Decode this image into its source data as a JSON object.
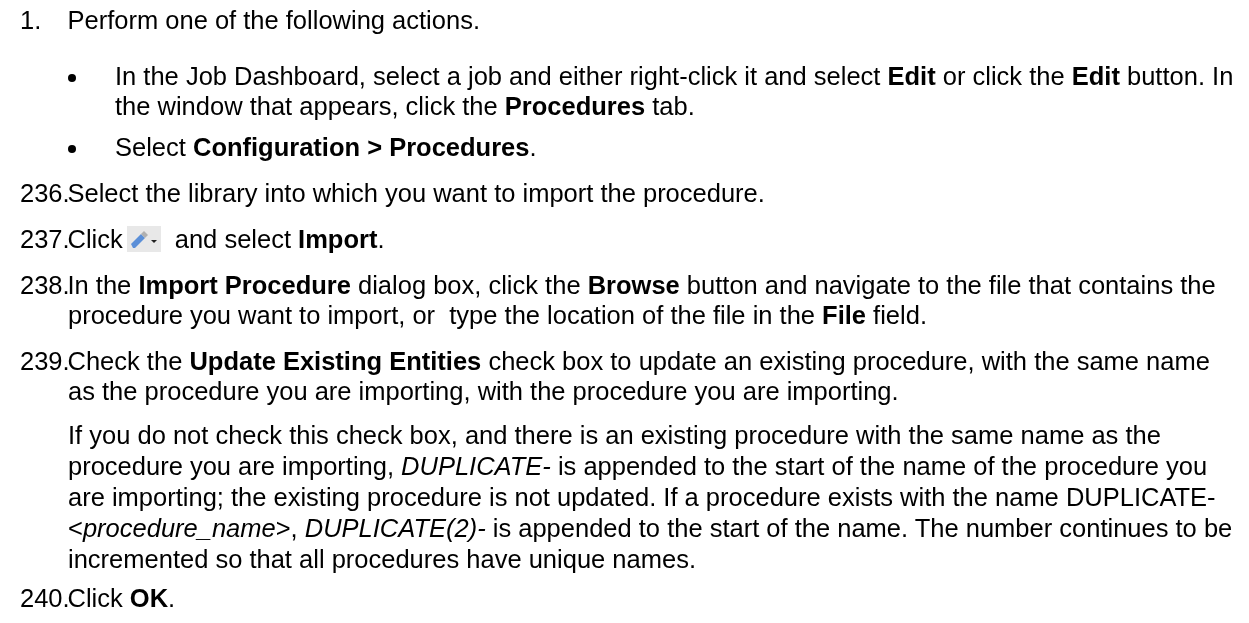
{
  "steps": [
    {
      "kind": "step",
      "number": "1.",
      "text": "Perform one of the following actions.",
      "children": [
        {
          "kind": "bullet",
          "text": "In the Job Dashboard, select a job and either right-click it and select **Edit** or click the **Edit** button. In the window that appears, click the **Procedures** tab."
        },
        {
          "kind": "bullet",
          "text": "Select **Configuration > Procedures**."
        }
      ]
    },
    {
      "kind": "step",
      "number": "236.",
      "text": "Select the library into which you want to import the procedure."
    },
    {
      "kind": "icon-step",
      "number": "237.",
      "text_before": "Click",
      "text_after": "and select **Import**."
    },
    {
      "kind": "step",
      "number": "238.",
      "text": "In the **Import Procedure** dialog box, click the **Browse** button and navigate to the file that contains the procedure you want to import, or  type the location of the file in the **File** field."
    },
    {
      "kind": "step",
      "number": "239.",
      "text": "Check the **Update Existing Entities** check box to update an existing procedure, with the same name  as the procedure you are importing, with the procedure you are importing."
    },
    {
      "kind": "note",
      "text": "If you do not check this check box, and there is an existing procedure with the same name as the procedure you are importing, *DUPLICATE-* is appended to the start of the name of the procedure you are importing; the existing procedure is not updated. If a procedure exists with the name DUPLICATE-<*procedure_name*>, *DUPLICATE(2)-* is appended to the start of the name. The number continues to be incremented so that all procedures have unique names."
    },
    {
      "kind": "step",
      "number": "240.",
      "text": "Click **OK**."
    }
  ]
}
